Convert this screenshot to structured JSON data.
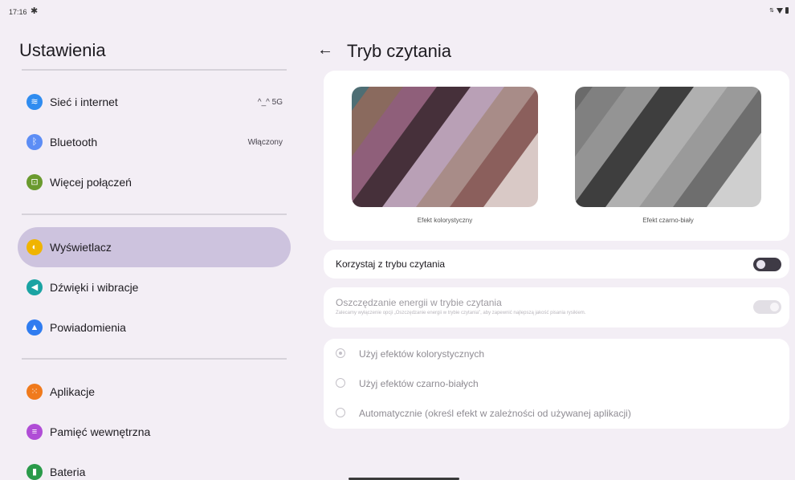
{
  "status_bar": {
    "time": "17:16"
  },
  "left_pane": {
    "title": "Ustawienia",
    "groups": [
      [
        {
          "label": "Sieć i internet",
          "value": "^_^ 5G",
          "icon": "wifi-icon",
          "color": "#2f8cf0",
          "selected": false
        },
        {
          "label": "Bluetooth",
          "value": "Włączony",
          "icon": "bluetooth-icon",
          "color": "#5c8df5",
          "selected": false
        },
        {
          "label": "Więcej połączeń",
          "value": "",
          "icon": "connected-devices-icon",
          "color": "#6a9a2e",
          "selected": false
        }
      ],
      [
        {
          "label": "Wyświetlacz",
          "value": "",
          "icon": "display-icon",
          "color": "#f0b400",
          "selected": true
        },
        {
          "label": "Dźwięki i wibracje",
          "value": "",
          "icon": "sound-icon",
          "color": "#1aa3a3",
          "selected": false
        },
        {
          "label": "Powiadomienia",
          "value": "",
          "icon": "bell-icon",
          "color": "#2f7cf0",
          "selected": false
        }
      ],
      [
        {
          "label": "Aplikacje",
          "value": "",
          "icon": "apps-icon",
          "color": "#f07a1c",
          "selected": false
        },
        {
          "label": "Pamięć wewnętrzna",
          "value": "",
          "icon": "storage-icon",
          "color": "#b04dd6",
          "selected": false
        },
        {
          "label": "Bateria",
          "value": "",
          "icon": "battery-icon",
          "color": "#2a9a4a",
          "selected": false
        }
      ]
    ]
  },
  "right_pane": {
    "title": "Tryb czytania",
    "previews": [
      {
        "caption": "Efekt kolorystyczny",
        "colors": [
          "#4e6e74",
          "#8a6a5e",
          "#8f5f7a",
          "#46303a",
          "#b9a0b6",
          "#a88c88",
          "#8b5f5c",
          "#d9c9c6"
        ]
      },
      {
        "caption": "Efekt czarno-biały",
        "colors": [
          "#6a6a6a",
          "#808080",
          "#949494",
          "#3e3e3e",
          "#b0b0b0",
          "#9a9a9a",
          "#6e6e6e",
          "#cfcfcf"
        ]
      }
    ],
    "reading_mode": {
      "label": "Korzystaj z trybu czytania",
      "enabled": false
    },
    "energy_saving": {
      "label": "Oszczędzanie energii w trybie czytania",
      "description": "Zalecamy wyłączenie opcji „Oszczędzanie energii w trybie czytania”, aby zapewnić najlepszą jakość pisania rysikiem.",
      "enabled": true
    },
    "effect_options": [
      {
        "label": "Użyj efektów kolorystycznych",
        "checked": true
      },
      {
        "label": "Użyj efektów czarno-białych",
        "checked": false
      },
      {
        "label": "Automatycznie (określ efekt w zależności od używanej aplikacji)",
        "checked": false
      }
    ]
  }
}
